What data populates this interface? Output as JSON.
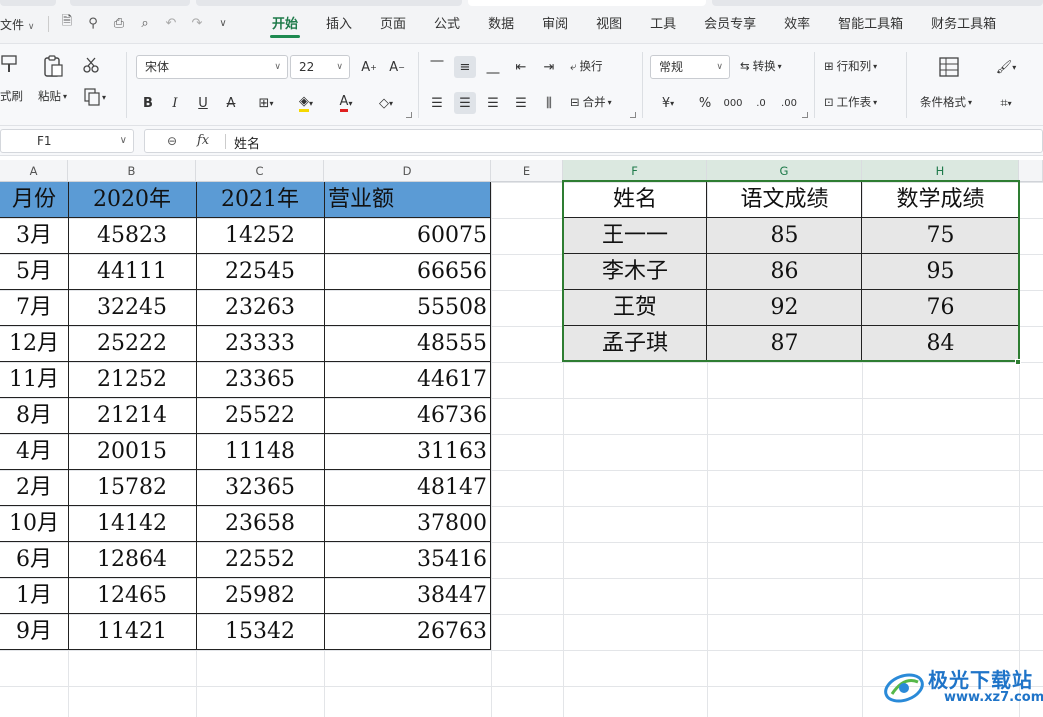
{
  "menubar": {
    "file_label": "文件",
    "tabs": [
      "开始",
      "插入",
      "页面",
      "公式",
      "数据",
      "审阅",
      "视图",
      "工具",
      "会员专享",
      "效率",
      "智能工具箱",
      "财务工具箱"
    ],
    "active_tab": "开始"
  },
  "ribbon": {
    "format_painter": "式刷",
    "paste": "粘贴",
    "font_name": "宋体",
    "font_size": "22",
    "wrap": "换行",
    "merge": "合并",
    "number_format": "常规",
    "convert": "转换",
    "row_col": "行和列",
    "worksheet": "工作表",
    "cond_format": "条件格式"
  },
  "formula_bar": {
    "name_box": "F1",
    "fx": "fx",
    "content": "姓名"
  },
  "columns": [
    "A",
    "B",
    "C",
    "D",
    "E",
    "F",
    "G",
    "H"
  ],
  "left_table": {
    "headers": [
      "月份",
      "2020年",
      "2021年",
      "营业额"
    ],
    "rows": [
      [
        "3月",
        "45823",
        "14252",
        "60075"
      ],
      [
        "5月",
        "44111",
        "22545",
        "66656"
      ],
      [
        "7月",
        "32245",
        "23263",
        "55508"
      ],
      [
        "12月",
        "25222",
        "23333",
        "48555"
      ],
      [
        "11月",
        "21252",
        "23365",
        "44617"
      ],
      [
        "8月",
        "21214",
        "25522",
        "46736"
      ],
      [
        "4月",
        "20015",
        "11148",
        "31163"
      ],
      [
        "2月",
        "15782",
        "32365",
        "48147"
      ],
      [
        "10月",
        "14142",
        "23658",
        "37800"
      ],
      [
        "6月",
        "12864",
        "22552",
        "35416"
      ],
      [
        "1月",
        "12465",
        "25982",
        "38447"
      ],
      [
        "9月",
        "11421",
        "15342",
        "26763"
      ]
    ],
    "header_color": "#5b9bd5"
  },
  "right_table": {
    "headers": [
      "姓名",
      "语文成绩",
      "数学成绩"
    ],
    "rows": [
      [
        "王一一",
        "85",
        "75"
      ],
      [
        "李木子",
        "86",
        "95"
      ],
      [
        "王贺",
        "92",
        "76"
      ],
      [
        "孟子琪",
        "87",
        "84"
      ]
    ],
    "selection_color": "#2e7d32"
  },
  "watermark": {
    "title": "极光下载站",
    "url": "www.xz7.com"
  }
}
